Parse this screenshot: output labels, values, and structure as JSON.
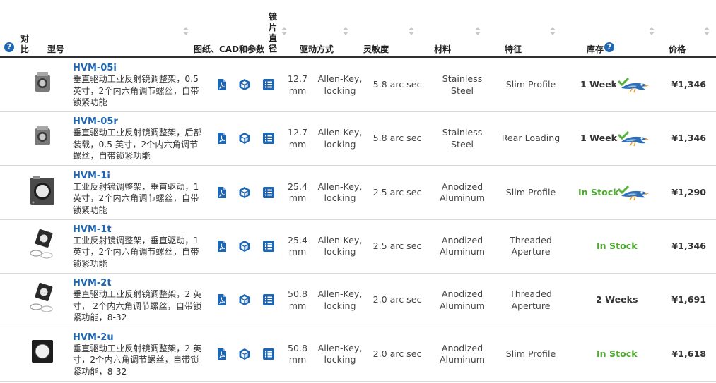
{
  "header": {
    "compare_line1": "对",
    "compare_line2": "比",
    "model": "型号",
    "docs": "图纸、CAD和参数",
    "diameter_chars": [
      "镜",
      "片",
      "直",
      "径"
    ],
    "drive": "驱动方式",
    "sensitivity": "灵敏度",
    "material": "材料",
    "feature": "特征",
    "stock": "库存",
    "price": "价格",
    "help_glyph": "?"
  },
  "rows": [
    {
      "part": "HVM-05i",
      "desc": "垂直驱动工业反射镜调整架，0.5 英寸，2个内六角调节螺丝，自带锁紧功能",
      "diameter_1": "12.7",
      "diameter_2": "mm",
      "drive_1": "Allen-Key,",
      "drive_2": "locking",
      "sensitivity": "5.8 arc sec",
      "material_1": "Stainless",
      "material_2": "Steel",
      "feature_1": "Slim Profile",
      "feature_2": "",
      "stock": "1 Week",
      "price": "¥1,346",
      "thumb": "small"
    },
    {
      "part": "HVM-05r",
      "desc": "垂直驱动工业反射镜调整架，后部装载，0.5 英寸，2个内六角调节螺丝，自带锁紧功能",
      "diameter_1": "12.7",
      "diameter_2": "mm",
      "drive_1": "Allen-Key,",
      "drive_2": "locking",
      "sensitivity": "5.8 arc sec",
      "material_1": "Stainless",
      "material_2": "Steel",
      "feature_1": "Rear Loading",
      "feature_2": "",
      "stock": "1 Week",
      "price": "¥1,346",
      "thumb": "small"
    },
    {
      "part": "HVM-1i",
      "desc": "工业反射镜调整架，垂直驱动，1 英寸，2个内六角调节螺丝，自带锁紧功能",
      "diameter_1": "25.4",
      "diameter_2": "mm",
      "drive_1": "Allen-Key,",
      "drive_2": "locking",
      "sensitivity": "2.5 arc sec",
      "material_1": "Anodized",
      "material_2": "Aluminum",
      "feature_1": "Slim Profile",
      "feature_2": "",
      "stock": "In Stock",
      "price": "¥1,290",
      "thumb": "large"
    },
    {
      "part": "HVM-1t",
      "desc": "工业反射镜调整架，垂直驱动，1 英寸，2个内六角调节螺丝，自带锁紧功能",
      "diameter_1": "25.4",
      "diameter_2": "mm",
      "drive_1": "Allen-Key,",
      "drive_2": "locking",
      "sensitivity": "2.5 arc sec",
      "material_1": "Anodized",
      "material_2": "Aluminum",
      "feature_1": "Threaded",
      "feature_2": "Aperture",
      "stock": "In Stock",
      "price": "¥1,346",
      "thumb": "rings"
    },
    {
      "part": "HVM-2t",
      "desc": "垂直驱动工业反射镜调整架，2 英寸， 2个内六角调节螺丝，自带锁紧功能，8-32",
      "diameter_1": "50.8",
      "diameter_2": "mm",
      "drive_1": "Allen-Key,",
      "drive_2": "locking",
      "sensitivity": "2.0 arc sec",
      "material_1": "Anodized",
      "material_2": "Aluminum",
      "feature_1": "Threaded",
      "feature_2": "Aperture",
      "stock": "2 Weeks",
      "price": "¥1,691",
      "thumb": "rings"
    },
    {
      "part": "HVM-2u",
      "desc": "垂直驱动工业反射镜调整架，2 英寸，2个内六角调节螺丝，自带锁紧功能，8-32",
      "diameter_1": "50.8",
      "diameter_2": "mm",
      "drive_1": "Allen-Key,",
      "drive_2": "locking",
      "sensitivity": "2.0 arc sec",
      "material_1": "Anodized",
      "material_2": "Aluminum",
      "feature_1": "Slim Profile",
      "feature_2": "",
      "stock": "In Stock",
      "price": "¥1,618",
      "thumb": "square"
    }
  ],
  "stock_status_colors": {
    "1 Week": "#333333",
    "2 Weeks": "#333333",
    "In Stock": "#4faa30"
  },
  "stock_has_hawk": [
    true,
    true,
    true,
    false,
    false,
    false
  ],
  "colors": {
    "link": "#1d66b3",
    "in_stock": "#4faa30",
    "icon": "#1d66b3"
  }
}
